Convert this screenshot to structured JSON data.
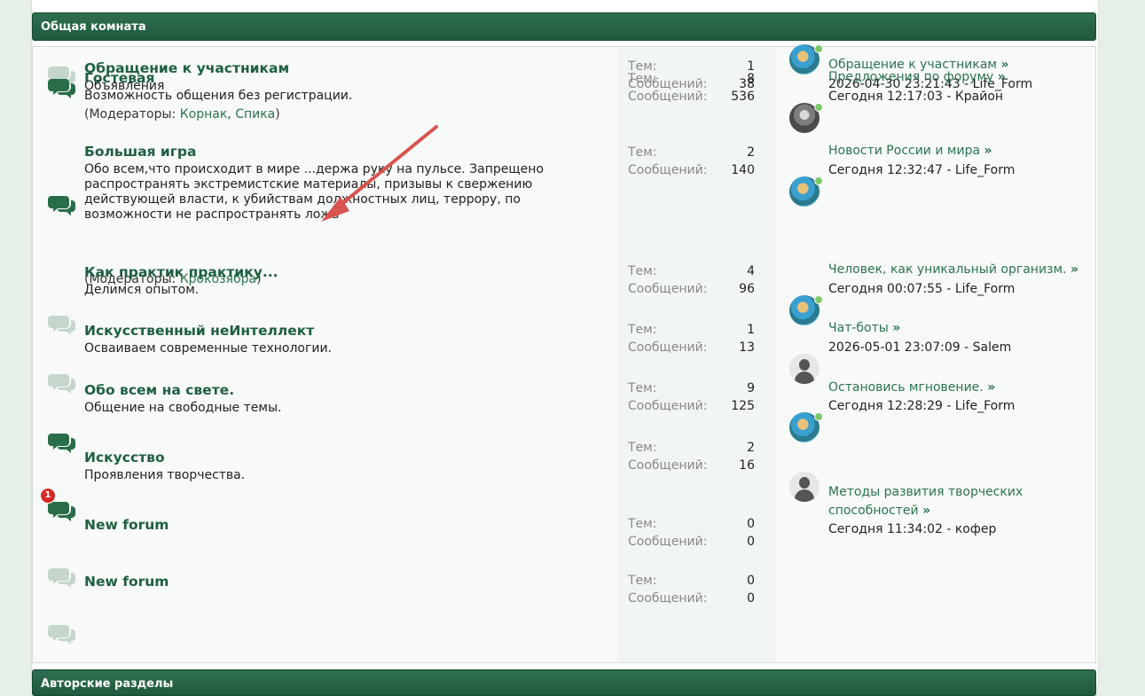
{
  "categories": {
    "general": "Общая комната",
    "authors": "Авторские разделы"
  },
  "labels": {
    "topics": "Тем:",
    "posts": "Сообщений:",
    "moderators_open": "(Модераторы: ",
    "moderators_close": ")",
    "mod_sep": ", ",
    "more_arrow": "»"
  },
  "forums": [
    {
      "title": "Обращение к участникам",
      "desc": "Объявления",
      "topics": "1",
      "posts": "38",
      "last_topic": "Обращение к участникам",
      "last_meta": "2026-04-30 23:21:43 - Life_Form",
      "avatar": "blue",
      "online": true,
      "unread": false
    },
    {
      "title": "Гостевая",
      "desc": "Возможность общения без регистрации.",
      "mods": [
        "Корнак",
        "Спика"
      ],
      "topics": "8",
      "posts": "536",
      "last_topic": "Предложения по форуму",
      "last_meta": "Сегодня 12:17:03 - Крайон",
      "avatar": "gray",
      "online": true,
      "unread": true
    },
    {
      "title": "Большая игра",
      "desc": "Обо всем,что происходит в мире ...держа руку на пульсе. Запрещено распространять экстремистские материалы, призывы к свержению действующей власти, к убийствам должностных лиц, террору, по возможности не распространять ложь",
      "mods": [
        "Крокозябра"
      ],
      "topics": "2",
      "posts": "140",
      "last_topic": "Новости России и мира",
      "last_meta": "Сегодня 12:32:47 - Life_Form",
      "avatar": "blue",
      "online": true,
      "unread": true
    },
    {
      "title": "Как практик практику...",
      "desc": "Делимся опытом.",
      "topics": "4",
      "posts": "96",
      "last_topic": "Человек, как уникальный организм.",
      "last_meta": "Сегодня 00:07:55 - Life_Form",
      "avatar": "blue",
      "online": true,
      "unread": false
    },
    {
      "title": "Искусственный неИнтеллект",
      "desc": "Осваиваем современные технологии.",
      "topics": "1",
      "posts": "13",
      "last_topic": "Чат-боты",
      "last_meta": "2026-05-01 23:07:09 - Salem",
      "avatar": "default",
      "online": false,
      "unread": false
    },
    {
      "title": "Обо всем на свете.",
      "desc": "Общение на свободные темы.",
      "topics": "9",
      "posts": "125",
      "last_topic": "Остановись мгновение.",
      "last_meta": "Сегодня 12:28:29 - Life_Form",
      "avatar": "blue",
      "online": true,
      "unread": true
    },
    {
      "title": "Искусство",
      "desc": "Проявления творчества.",
      "topics": "2",
      "posts": "16",
      "last_topic": "Методы развития творческих способностей",
      "last_meta": "Сегодня 11:34:02 - кофер",
      "avatar": "default",
      "online": false,
      "unread": true,
      "badge": "1"
    },
    {
      "title": "New forum",
      "desc": "",
      "topics": "0",
      "posts": "0",
      "unread": false
    },
    {
      "title": "New forum",
      "desc": "",
      "topics": "0",
      "posts": "0",
      "unread": false
    }
  ],
  "colors": {
    "header_bg": "#1e5a3c",
    "title": "#1f5f40",
    "link": "#2c7350",
    "icon_read": "#c5d6cb",
    "icon_unread": "#2a6e49",
    "badge": "#d22a25",
    "online": "#7cc96a",
    "annotation_arrow": "#d9534f"
  },
  "icons": {
    "forum": "speech-bubbles-icon",
    "avatar_default": "user-silhouette-icon"
  }
}
